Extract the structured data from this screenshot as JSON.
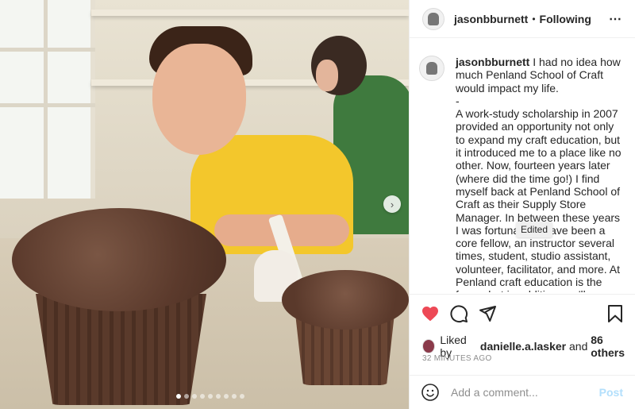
{
  "header": {
    "username": "jasonbburnett",
    "separator": "•",
    "follow_status": "Following",
    "more_icon": "⋯"
  },
  "caption": {
    "username": "jasonbburnett",
    "text": "I had no idea how much Penland School of Craft would impact my life.\n-\nA work-study scholarship in 2007 provided an opportunity not only to expand my craft education, but it introduced me to a place like no other. Now, fourteen years later (where did the time go!) I find myself back at Penland School of Craft as their Supply Store Manager. In between these years I was fortunate to have been a core fellow, an instructor several times, student, studio assistant, volunteer, facilitator, and more. At Penland craft education is the focus, but in addition you'll discover a community of creative types, leaders, ambassadors for social change, and so much more."
  },
  "tooltip": {
    "text": "Edited"
  },
  "media": {
    "carousel_count": 9,
    "active_index": 0,
    "next_icon": "›"
  },
  "actions": {
    "like_icon": "heart-filled",
    "comment_icon": "comment-bubble",
    "share_icon": "paper-plane",
    "save_icon": "bookmark",
    "like_color": "#ed4956"
  },
  "likes": {
    "prefix": "Liked by",
    "user": "danielle.a.lasker",
    "conjunction": "and",
    "others": "86 others"
  },
  "timestamp": "32 MINUTES AGO",
  "add_comment": {
    "placeholder": "Add a comment...",
    "post_label": "Post"
  }
}
